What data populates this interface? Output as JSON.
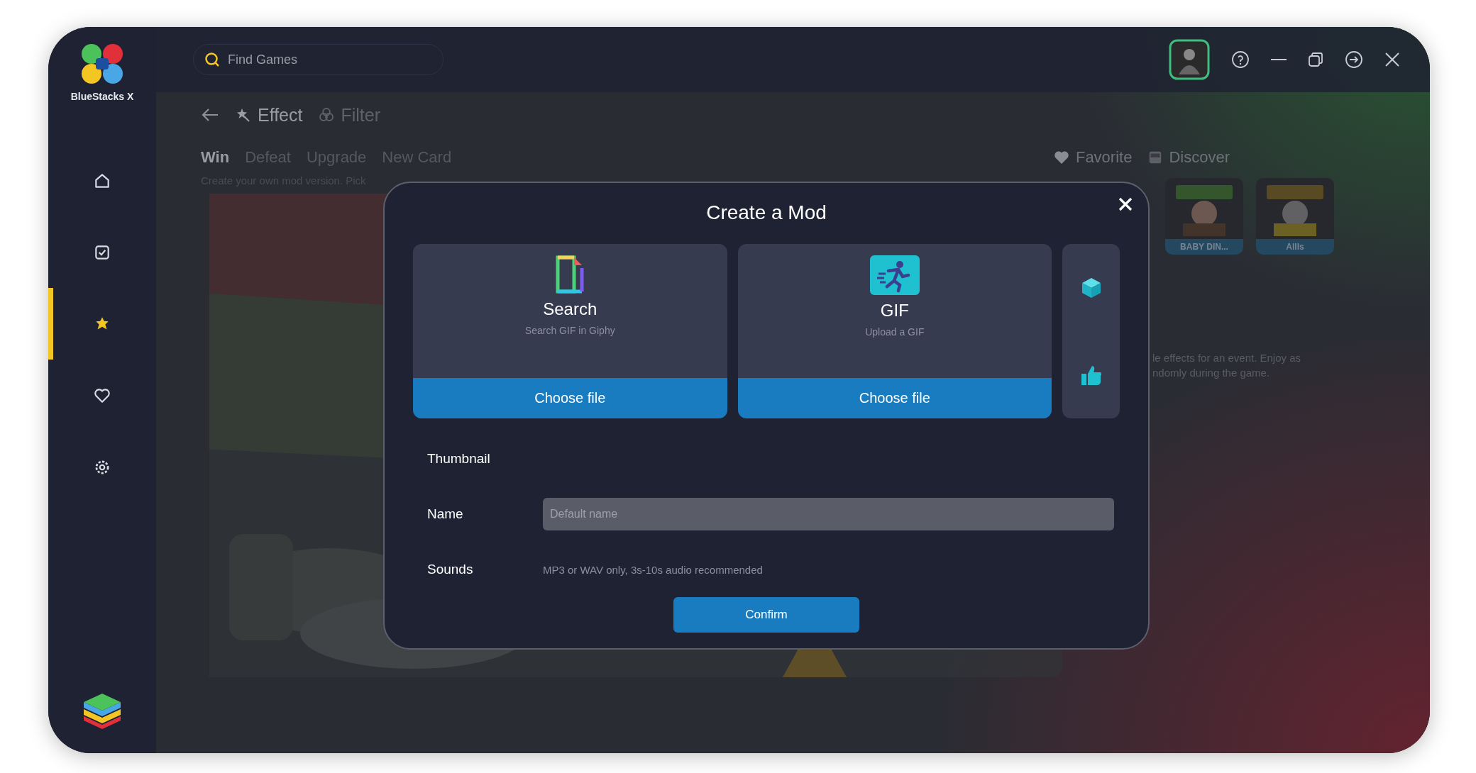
{
  "app": {
    "name": "BlueStacks X"
  },
  "search": {
    "placeholder": "Find Games"
  },
  "sidebar": {
    "items": [
      {
        "kind": "home",
        "selected": false
      },
      {
        "kind": "games",
        "selected": false
      },
      {
        "kind": "mods",
        "selected": true
      },
      {
        "kind": "favorites",
        "selected": false
      },
      {
        "kind": "settings",
        "selected": false
      }
    ]
  },
  "modes": [
    {
      "kind": "effect",
      "label": "Effect",
      "selected": true
    },
    {
      "kind": "filter",
      "label": "Filter",
      "selected": false
    }
  ],
  "events": [
    {
      "label": "Win",
      "selected": true
    },
    {
      "label": "Defeat",
      "selected": false
    },
    {
      "label": "Upgrade",
      "selected": false
    },
    {
      "label": "New Card",
      "selected": false
    }
  ],
  "description": "Create your own mod version. Pick",
  "links": [
    {
      "kind": "favorite",
      "label": "Favorite"
    },
    {
      "kind": "discover",
      "label": "Discover"
    }
  ],
  "mods": [
    {
      "label": "BABY DIN..."
    },
    {
      "label": "Allls"
    }
  ],
  "side_text": [
    "le effects for an event. Enjoy as",
    "ndomly during the game."
  ],
  "modal": {
    "title": "Create a Mod",
    "sources": [
      {
        "kind": "giphy",
        "title": "Search",
        "subtitle": "Search GIF in Giphy",
        "button": "Choose file"
      },
      {
        "kind": "gif",
        "title": "GIF",
        "subtitle": "Upload a GIF",
        "button": "Choose file"
      }
    ],
    "tools": [
      {
        "kind": "cube"
      },
      {
        "kind": "thumb"
      }
    ],
    "fields": [
      {
        "kind": "label",
        "label": "Thumbnail"
      },
      {
        "kind": "input",
        "label": "Name",
        "placeholder": "Default name"
      },
      {
        "kind": "hint",
        "label": "Sounds",
        "hint": "MP3 or WAV only, 3s-10s audio recommended"
      }
    ],
    "confirm": "Confirm"
  }
}
